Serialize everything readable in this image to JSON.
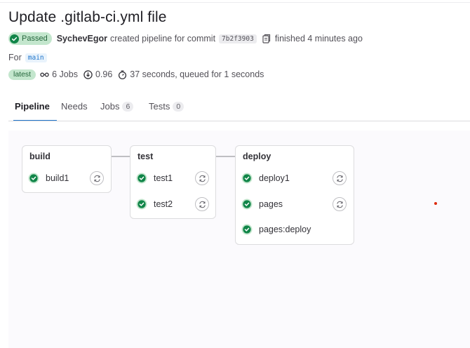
{
  "title": "Update .gitlab-ci.yml file",
  "status": {
    "label": "Passed",
    "color": "#24663b"
  },
  "author": "SychevEgor",
  "created_text": "created pipeline for commit",
  "commit_sha": "7b2f3903",
  "finished_text": "finished 4 minutes ago",
  "for_label": "For",
  "branch": "main",
  "latest_badge": "latest",
  "jobs_count_text": "6 Jobs",
  "coverage_text": "0.96",
  "duration_text": "37 seconds, queued for 1 seconds",
  "tabs": [
    {
      "label": "Pipeline",
      "count": null
    },
    {
      "label": "Needs",
      "count": null
    },
    {
      "label": "Jobs",
      "count": "6"
    },
    {
      "label": "Tests",
      "count": "0"
    }
  ],
  "stages": [
    {
      "name": "build",
      "jobs": [
        {
          "name": "build1",
          "status": "success",
          "action": "retry"
        }
      ]
    },
    {
      "name": "test",
      "jobs": [
        {
          "name": "test1",
          "status": "success",
          "action": "retry"
        },
        {
          "name": "test2",
          "status": "success",
          "action": "retry"
        }
      ]
    },
    {
      "name": "deploy",
      "jobs": [
        {
          "name": "deploy1",
          "status": "success",
          "action": "retry"
        },
        {
          "name": "pages",
          "status": "success",
          "action": "retry"
        },
        {
          "name": "pages:deploy",
          "status": "success",
          "action": null
        }
      ]
    }
  ],
  "colors": {
    "accent": "#1f75cb",
    "success": "#108548",
    "success_bg": "#c3e6cd"
  }
}
